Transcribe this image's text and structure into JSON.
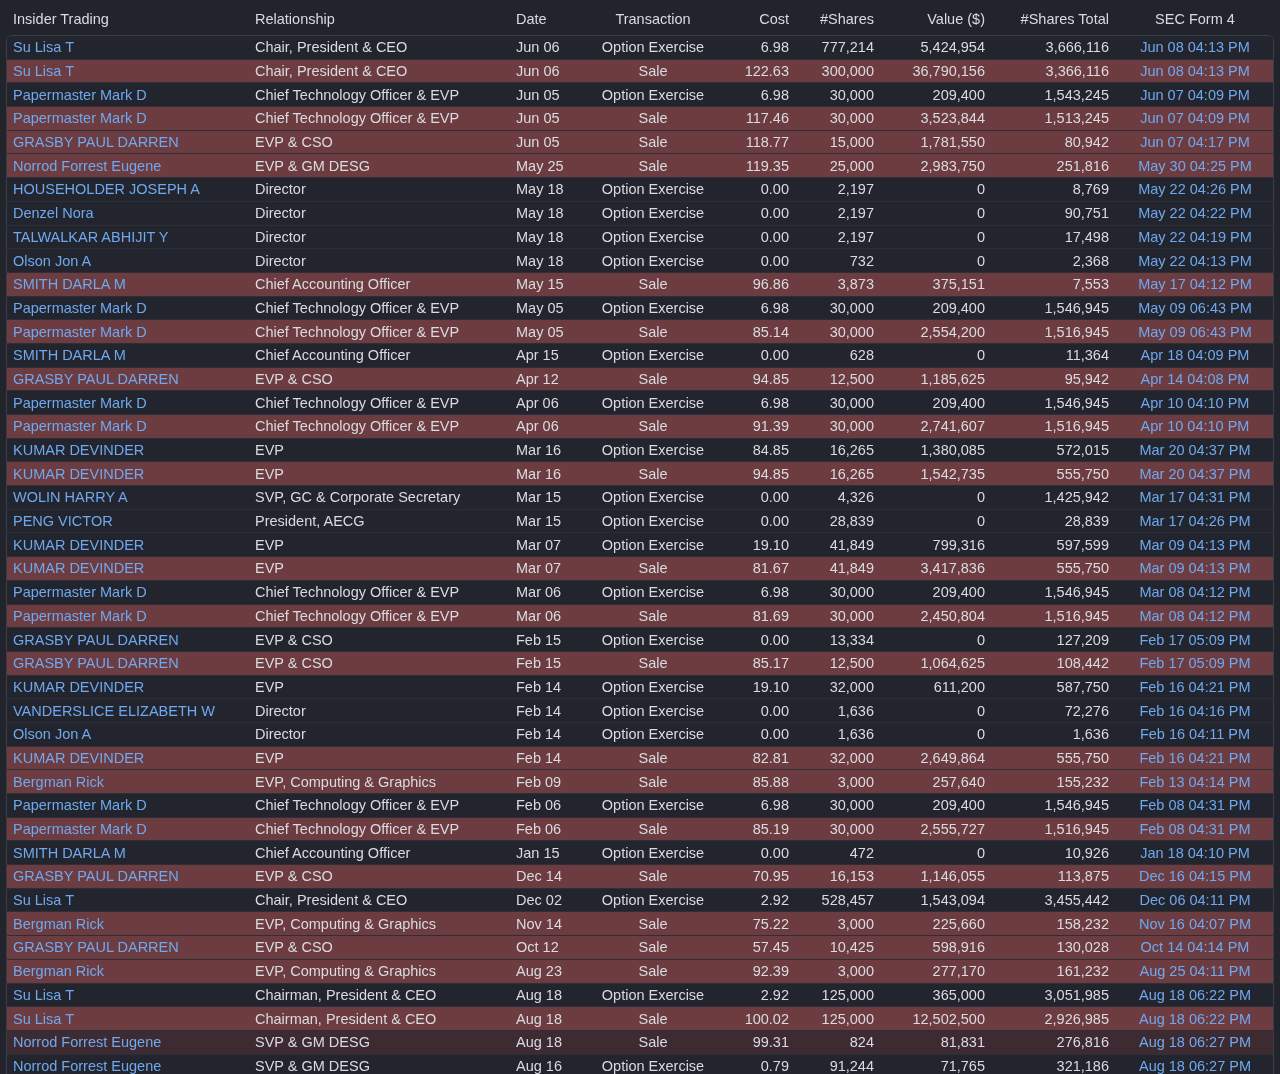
{
  "table": {
    "columns": [
      "Insider Trading",
      "Relationship",
      "Date",
      "Transaction",
      "Cost",
      "#Shares",
      "Value ($)",
      "#Shares Total",
      "SEC Form 4"
    ],
    "rows": [
      {
        "insider": "Su Lisa T",
        "relationship": "Chair, President & CEO",
        "date": "Jun 06",
        "transaction": "Option Exercise",
        "cost": "6.98",
        "shares": "777,214",
        "value": "5,424,954",
        "shares_total": "3,666,116",
        "sec_form_4": "Jun 08 04:13 PM",
        "color": "#22252d"
      },
      {
        "insider": "Su Lisa T",
        "relationship": "Chair, President & CEO",
        "date": "Jun 06",
        "transaction": "Sale",
        "cost": "122.63",
        "shares": "300,000",
        "value": "36,790,156",
        "shares_total": "3,366,116",
        "sec_form_4": "Jun 08 04:13 PM",
        "color": "#6d3c41"
      },
      {
        "insider": "Papermaster Mark D",
        "relationship": "Chief Technology Officer & EVP",
        "date": "Jun 05",
        "transaction": "Option Exercise",
        "cost": "6.98",
        "shares": "30,000",
        "value": "209,400",
        "shares_total": "1,543,245",
        "sec_form_4": "Jun 07 04:09 PM",
        "color": "#22252d"
      },
      {
        "insider": "Papermaster Mark D",
        "relationship": "Chief Technology Officer & EVP",
        "date": "Jun 05",
        "transaction": "Sale",
        "cost": "117.46",
        "shares": "30,000",
        "value": "3,523,844",
        "shares_total": "1,513,245",
        "sec_form_4": "Jun 07 04:09 PM",
        "color": "#6d3c41"
      },
      {
        "insider": "GRASBY PAUL DARREN",
        "relationship": "EVP & CSO",
        "date": "Jun 05",
        "transaction": "Sale",
        "cost": "118.77",
        "shares": "15,000",
        "value": "1,781,550",
        "shares_total": "80,942",
        "sec_form_4": "Jun 07 04:17 PM",
        "color": "#6d3c41"
      },
      {
        "insider": "Norrod Forrest Eugene",
        "relationship": "EVP & GM DESG",
        "date": "May 25",
        "transaction": "Sale",
        "cost": "119.35",
        "shares": "25,000",
        "value": "2,983,750",
        "shares_total": "251,816",
        "sec_form_4": "May 30 04:25 PM",
        "color": "#6d3c41"
      },
      {
        "insider": "HOUSEHOLDER JOSEPH A",
        "relationship": "Director",
        "date": "May 18",
        "transaction": "Option Exercise",
        "cost": "0.00",
        "shares": "2,197",
        "value": "0",
        "shares_total": "8,769",
        "sec_form_4": "May 22 04:26 PM",
        "color": "#22252d"
      },
      {
        "insider": "Denzel Nora",
        "relationship": "Director",
        "date": "May 18",
        "transaction": "Option Exercise",
        "cost": "0.00",
        "shares": "2,197",
        "value": "0",
        "shares_total": "90,751",
        "sec_form_4": "May 22 04:22 PM",
        "color": "#22252d"
      },
      {
        "insider": "TALWALKAR ABHIJIT Y",
        "relationship": "Director",
        "date": "May 18",
        "transaction": "Option Exercise",
        "cost": "0.00",
        "shares": "2,197",
        "value": "0",
        "shares_total": "17,498",
        "sec_form_4": "May 22 04:19 PM",
        "color": "#22252d"
      },
      {
        "insider": "Olson Jon A",
        "relationship": "Director",
        "date": "May 18",
        "transaction": "Option Exercise",
        "cost": "0.00",
        "shares": "732",
        "value": "0",
        "shares_total": "2,368",
        "sec_form_4": "May 22 04:13 PM",
        "color": "#22252d"
      },
      {
        "insider": "SMITH DARLA M",
        "relationship": "Chief Accounting Officer",
        "date": "May 15",
        "transaction": "Sale",
        "cost": "96.86",
        "shares": "3,873",
        "value": "375,151",
        "shares_total": "7,553",
        "sec_form_4": "May 17 04:12 PM",
        "color": "#6d3c41"
      },
      {
        "insider": "Papermaster Mark D",
        "relationship": "Chief Technology Officer & EVP",
        "date": "May 05",
        "transaction": "Option Exercise",
        "cost": "6.98",
        "shares": "30,000",
        "value": "209,400",
        "shares_total": "1,546,945",
        "sec_form_4": "May 09 06:43 PM",
        "color": "#22252d"
      },
      {
        "insider": "Papermaster Mark D",
        "relationship": "Chief Technology Officer & EVP",
        "date": "May 05",
        "transaction": "Sale",
        "cost": "85.14",
        "shares": "30,000",
        "value": "2,554,200",
        "shares_total": "1,516,945",
        "sec_form_4": "May 09 06:43 PM",
        "color": "#6d3c41"
      },
      {
        "insider": "SMITH DARLA M",
        "relationship": "Chief Accounting Officer",
        "date": "Apr 15",
        "transaction": "Option Exercise",
        "cost": "0.00",
        "shares": "628",
        "value": "0",
        "shares_total": "11,364",
        "sec_form_4": "Apr 18 04:09 PM",
        "color": "#22252d"
      },
      {
        "insider": "GRASBY PAUL DARREN",
        "relationship": "EVP & CSO",
        "date": "Apr 12",
        "transaction": "Sale",
        "cost": "94.85",
        "shares": "12,500",
        "value": "1,185,625",
        "shares_total": "95,942",
        "sec_form_4": "Apr 14 04:08 PM",
        "color": "#6d3c41"
      },
      {
        "insider": "Papermaster Mark D",
        "relationship": "Chief Technology Officer & EVP",
        "date": "Apr 06",
        "transaction": "Option Exercise",
        "cost": "6.98",
        "shares": "30,000",
        "value": "209,400",
        "shares_total": "1,546,945",
        "sec_form_4": "Apr 10 04:10 PM",
        "color": "#22252d"
      },
      {
        "insider": "Papermaster Mark D",
        "relationship": "Chief Technology Officer & EVP",
        "date": "Apr 06",
        "transaction": "Sale",
        "cost": "91.39",
        "shares": "30,000",
        "value": "2,741,607",
        "shares_total": "1,516,945",
        "sec_form_4": "Apr 10 04:10 PM",
        "color": "#6d3c41"
      },
      {
        "insider": "KUMAR DEVINDER",
        "relationship": "EVP",
        "date": "Mar 16",
        "transaction": "Option Exercise",
        "cost": "84.85",
        "shares": "16,265",
        "value": "1,380,085",
        "shares_total": "572,015",
        "sec_form_4": "Mar 20 04:37 PM",
        "color": "#22252d"
      },
      {
        "insider": "KUMAR DEVINDER",
        "relationship": "EVP",
        "date": "Mar 16",
        "transaction": "Sale",
        "cost": "94.85",
        "shares": "16,265",
        "value": "1,542,735",
        "shares_total": "555,750",
        "sec_form_4": "Mar 20 04:37 PM",
        "color": "#6d3c41"
      },
      {
        "insider": "WOLIN HARRY A",
        "relationship": "SVP, GC & Corporate Secretary",
        "date": "Mar 15",
        "transaction": "Option Exercise",
        "cost": "0.00",
        "shares": "4,326",
        "value": "0",
        "shares_total": "1,425,942",
        "sec_form_4": "Mar 17 04:31 PM",
        "color": "#22252d"
      },
      {
        "insider": "PENG VICTOR",
        "relationship": "President, AECG",
        "date": "Mar 15",
        "transaction": "Option Exercise",
        "cost": "0.00",
        "shares": "28,839",
        "value": "0",
        "shares_total": "28,839",
        "sec_form_4": "Mar 17 04:26 PM",
        "color": "#22252d"
      },
      {
        "insider": "KUMAR DEVINDER",
        "relationship": "EVP",
        "date": "Mar 07",
        "transaction": "Option Exercise",
        "cost": "19.10",
        "shares": "41,849",
        "value": "799,316",
        "shares_total": "597,599",
        "sec_form_4": "Mar 09 04:13 PM",
        "color": "#22252d"
      },
      {
        "insider": "KUMAR DEVINDER",
        "relationship": "EVP",
        "date": "Mar 07",
        "transaction": "Sale",
        "cost": "81.67",
        "shares": "41,849",
        "value": "3,417,836",
        "shares_total": "555,750",
        "sec_form_4": "Mar 09 04:13 PM",
        "color": "#6d3c41"
      },
      {
        "insider": "Papermaster Mark D",
        "relationship": "Chief Technology Officer & EVP",
        "date": "Mar 06",
        "transaction": "Option Exercise",
        "cost": "6.98",
        "shares": "30,000",
        "value": "209,400",
        "shares_total": "1,546,945",
        "sec_form_4": "Mar 08 04:12 PM",
        "color": "#22252d"
      },
      {
        "insider": "Papermaster Mark D",
        "relationship": "Chief Technology Officer & EVP",
        "date": "Mar 06",
        "transaction": "Sale",
        "cost": "81.69",
        "shares": "30,000",
        "value": "2,450,804",
        "shares_total": "1,516,945",
        "sec_form_4": "Mar 08 04:12 PM",
        "color": "#6d3c41"
      },
      {
        "insider": "GRASBY PAUL DARREN",
        "relationship": "EVP & CSO",
        "date": "Feb 15",
        "transaction": "Option Exercise",
        "cost": "0.00",
        "shares": "13,334",
        "value": "0",
        "shares_total": "127,209",
        "sec_form_4": "Feb 17 05:09 PM",
        "color": "#22252d"
      },
      {
        "insider": "GRASBY PAUL DARREN",
        "relationship": "EVP & CSO",
        "date": "Feb 15",
        "transaction": "Sale",
        "cost": "85.17",
        "shares": "12,500",
        "value": "1,064,625",
        "shares_total": "108,442",
        "sec_form_4": "Feb 17 05:09 PM",
        "color": "#6d3c41"
      },
      {
        "insider": "KUMAR DEVINDER",
        "relationship": "EVP",
        "date": "Feb 14",
        "transaction": "Option Exercise",
        "cost": "19.10",
        "shares": "32,000",
        "value": "611,200",
        "shares_total": "587,750",
        "sec_form_4": "Feb 16 04:21 PM",
        "color": "#22252d"
      },
      {
        "insider": "VANDERSLICE ELIZABETH W",
        "relationship": "Director",
        "date": "Feb 14",
        "transaction": "Option Exercise",
        "cost": "0.00",
        "shares": "1,636",
        "value": "0",
        "shares_total": "72,276",
        "sec_form_4": "Feb 16 04:16 PM",
        "color": "#22252d"
      },
      {
        "insider": "Olson Jon A",
        "relationship": "Director",
        "date": "Feb 14",
        "transaction": "Option Exercise",
        "cost": "0.00",
        "shares": "1,636",
        "value": "0",
        "shares_total": "1,636",
        "sec_form_4": "Feb 16 04:11 PM",
        "color": "#22252d"
      },
      {
        "insider": "KUMAR DEVINDER",
        "relationship": "EVP",
        "date": "Feb 14",
        "transaction": "Sale",
        "cost": "82.81",
        "shares": "32,000",
        "value": "2,649,864",
        "shares_total": "555,750",
        "sec_form_4": "Feb 16 04:21 PM",
        "color": "#6d3c41"
      },
      {
        "insider": "Bergman Rick",
        "relationship": "EVP, Computing & Graphics",
        "date": "Feb 09",
        "transaction": "Sale",
        "cost": "85.88",
        "shares": "3,000",
        "value": "257,640",
        "shares_total": "155,232",
        "sec_form_4": "Feb 13 04:14 PM",
        "color": "#6d3c41"
      },
      {
        "insider": "Papermaster Mark D",
        "relationship": "Chief Technology Officer & EVP",
        "date": "Feb 06",
        "transaction": "Option Exercise",
        "cost": "6.98",
        "shares": "30,000",
        "value": "209,400",
        "shares_total": "1,546,945",
        "sec_form_4": "Feb 08 04:31 PM",
        "color": "#22252d"
      },
      {
        "insider": "Papermaster Mark D",
        "relationship": "Chief Technology Officer & EVP",
        "date": "Feb 06",
        "transaction": "Sale",
        "cost": "85.19",
        "shares": "30,000",
        "value": "2,555,727",
        "shares_total": "1,516,945",
        "sec_form_4": "Feb 08 04:31 PM",
        "color": "#6d3c41"
      },
      {
        "insider": "SMITH DARLA M",
        "relationship": "Chief Accounting Officer",
        "date": "Jan 15",
        "transaction": "Option Exercise",
        "cost": "0.00",
        "shares": "472",
        "value": "0",
        "shares_total": "10,926",
        "sec_form_4": "Jan 18 04:10 PM",
        "color": "#22252d"
      },
      {
        "insider": "GRASBY PAUL DARREN",
        "relationship": "EVP & CSO",
        "date": "Dec 14",
        "transaction": "Sale",
        "cost": "70.95",
        "shares": "16,153",
        "value": "1,146,055",
        "shares_total": "113,875",
        "sec_form_4": "Dec 16 04:15 PM",
        "color": "#6d3c41"
      },
      {
        "insider": "Su Lisa T",
        "relationship": "Chair, President & CEO",
        "date": "Dec 02",
        "transaction": "Option Exercise",
        "cost": "2.92",
        "shares": "528,457",
        "value": "1,543,094",
        "shares_total": "3,455,442",
        "sec_form_4": "Dec 06 04:11 PM",
        "color": "#22252d"
      },
      {
        "insider": "Bergman Rick",
        "relationship": "EVP, Computing & Graphics",
        "date": "Nov 14",
        "transaction": "Sale",
        "cost": "75.22",
        "shares": "3,000",
        "value": "225,660",
        "shares_total": "158,232",
        "sec_form_4": "Nov 16 04:07 PM",
        "color": "#6d3c41"
      },
      {
        "insider": "GRASBY PAUL DARREN",
        "relationship": "EVP & CSO",
        "date": "Oct 12",
        "transaction": "Sale",
        "cost": "57.45",
        "shares": "10,425",
        "value": "598,916",
        "shares_total": "130,028",
        "sec_form_4": "Oct 14 04:14 PM",
        "color": "#6d3c41"
      },
      {
        "insider": "Bergman Rick",
        "relationship": "EVP, Computing & Graphics",
        "date": "Aug 23",
        "transaction": "Sale",
        "cost": "92.39",
        "shares": "3,000",
        "value": "277,170",
        "shares_total": "161,232",
        "sec_form_4": "Aug 25 04:11 PM",
        "color": "#6d3c41"
      },
      {
        "insider": "Su Lisa T",
        "relationship": "Chairman, President & CEO",
        "date": "Aug 18",
        "transaction": "Option Exercise",
        "cost": "2.92",
        "shares": "125,000",
        "value": "365,000",
        "shares_total": "3,051,985",
        "sec_form_4": "Aug 18 06:22 PM",
        "color": "#22252d"
      },
      {
        "insider": "Su Lisa T",
        "relationship": "Chairman, President & CEO",
        "date": "Aug 18",
        "transaction": "Sale",
        "cost": "100.02",
        "shares": "125,000",
        "value": "12,502,500",
        "shares_total": "2,926,985",
        "sec_form_4": "Aug 18 06:22 PM",
        "color": "#6d3c41"
      },
      {
        "insider": "Norrod Forrest Eugene",
        "relationship": "SVP & GM DESG",
        "date": "Aug 18",
        "transaction": "Sale",
        "cost": "99.31",
        "shares": "824",
        "value": "81,831",
        "shares_total": "276,816",
        "sec_form_4": "Aug 18 06:27 PM",
        "color": "#3d2b31"
      },
      {
        "insider": "Norrod Forrest Eugene",
        "relationship": "SVP & GM DESG",
        "date": "Aug 16",
        "transaction": "Option Exercise",
        "cost": "0.79",
        "shares": "91,244",
        "value": "71,765",
        "shares_total": "321,186",
        "sec_form_4": "Aug 18 06:27 PM",
        "color": "#22252d"
      }
    ]
  }
}
